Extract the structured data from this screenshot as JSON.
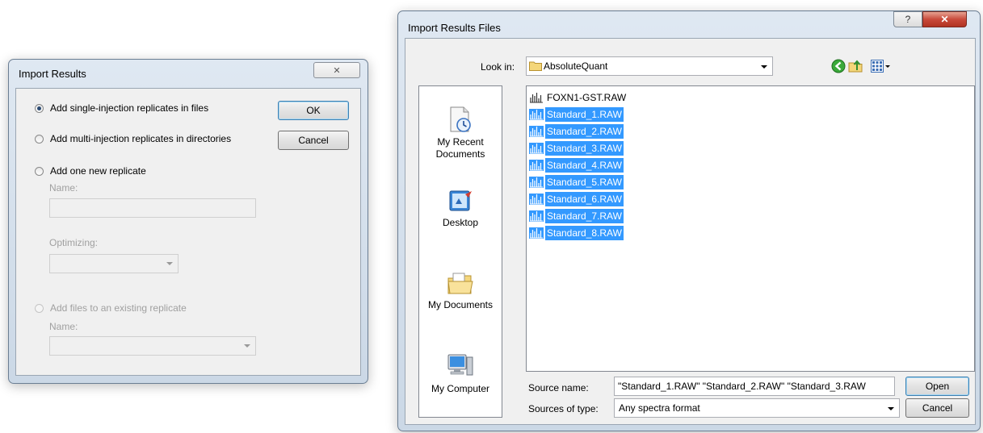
{
  "import_results": {
    "title": "Import Results",
    "close_symbol": "✕",
    "options": [
      {
        "label": "Add single-injection replicates in files",
        "checked": true,
        "enabled": true
      },
      {
        "label": "Add multi-injection replicates in directories",
        "checked": false,
        "enabled": true
      },
      {
        "label": "Add one new replicate",
        "checked": false,
        "enabled": true
      },
      {
        "label": "Add files to an existing replicate",
        "checked": false,
        "enabled": false
      }
    ],
    "ok_label": "OK",
    "cancel_label": "Cancel",
    "name_label": "Name:",
    "name_value": "",
    "optimizing_label": "Optimizing:",
    "optimizing_value": "",
    "existing_name_label": "Name:",
    "existing_name_value": ""
  },
  "import_files": {
    "title": "Import Results Files",
    "help_symbol": "?",
    "close_symbol": "✕",
    "look_in_label": "Look in:",
    "look_in_value": "AbsoluteQuant",
    "places": [
      {
        "lines": [
          "My Recent",
          "Documents"
        ],
        "icon": "recent-documents-icon"
      },
      {
        "lines": [
          "Desktop"
        ],
        "icon": "desktop-icon"
      },
      {
        "lines": [
          "My Documents"
        ],
        "icon": "my-documents-icon"
      },
      {
        "lines": [
          "My Computer"
        ],
        "icon": "my-computer-icon"
      }
    ],
    "files": [
      {
        "name": "FOXN1-GST.RAW",
        "selected": false
      },
      {
        "name": "Standard_1.RAW",
        "selected": true
      },
      {
        "name": "Standard_2.RAW",
        "selected": true
      },
      {
        "name": "Standard_3.RAW",
        "selected": true
      },
      {
        "name": "Standard_4.RAW",
        "selected": true
      },
      {
        "name": "Standard_5.RAW",
        "selected": true
      },
      {
        "name": "Standard_6.RAW",
        "selected": true
      },
      {
        "name": "Standard_7.RAW",
        "selected": true
      },
      {
        "name": "Standard_8.RAW",
        "selected": true
      }
    ],
    "source_name_label": "Source name:",
    "source_name_value": "\"Standard_1.RAW\" \"Standard_2.RAW\" \"Standard_3.RAW",
    "sources_type_label": "Sources of type:",
    "sources_type_value": "Any spectra format",
    "open_label": "Open",
    "cancel_label": "Cancel"
  },
  "colors": {
    "selection": "#3399ff",
    "window_bg": "#f0f0f0",
    "close_red": "#c94a3b"
  }
}
